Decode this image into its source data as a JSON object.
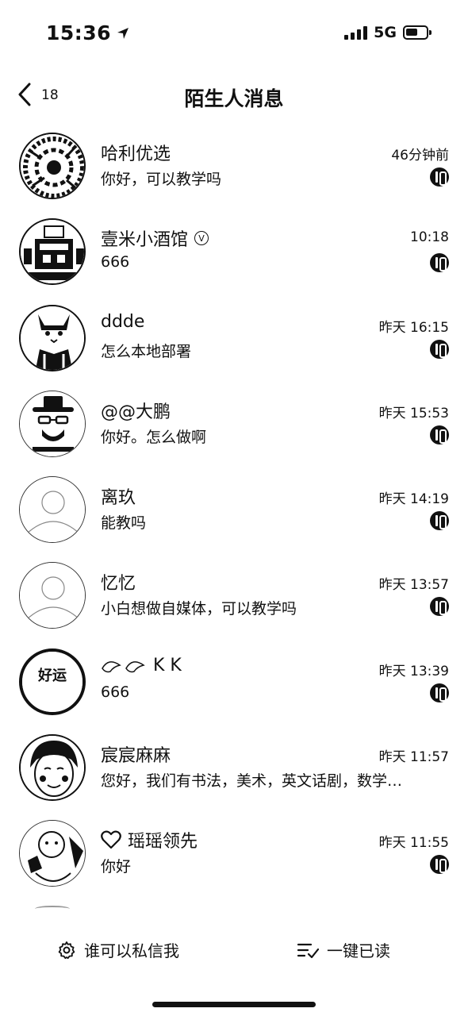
{
  "status_bar": {
    "time": "15:36",
    "network": "5G"
  },
  "nav": {
    "back_count": "18",
    "title": "陌生人消息"
  },
  "conversations": [
    {
      "name": "哈利优选",
      "message": "你好，可以教学吗",
      "time": "46分钟前",
      "verified": false
    },
    {
      "name": "壹米小酒馆",
      "message": "666",
      "time": "10:18",
      "verified": true
    },
    {
      "name": "ddde",
      "message": "怎么本地部署",
      "time": "昨天 16:15",
      "verified": false
    },
    {
      "name": "@@大鹏",
      "message": "你好。怎么做啊",
      "time": "昨天 15:53",
      "verified": false
    },
    {
      "name": "离玖",
      "message": "能教吗",
      "time": "昨天 14:19",
      "verified": false
    },
    {
      "name": "忆忆",
      "message": "小白想做自媒体，可以教学吗",
      "time": "昨天 13:57",
      "verified": false
    },
    {
      "name": "K K",
      "message": "666",
      "time": "昨天 13:39",
      "verified": false
    },
    {
      "name": "宸宸麻麻",
      "message": "您好，我们有书法，美术，英文话剧，数学…",
      "time": "昨天 11:57",
      "verified": false
    },
    {
      "name": "瑶瑶领先",
      "message": "你好",
      "time": "昨天 11:55",
      "verified": false
    }
  ],
  "avatar_texts": {
    "kk_avatar": "好运"
  },
  "bottom_bar": {
    "privacy_label": "谁可以私信我",
    "mark_all_read_label": "一键已读"
  }
}
